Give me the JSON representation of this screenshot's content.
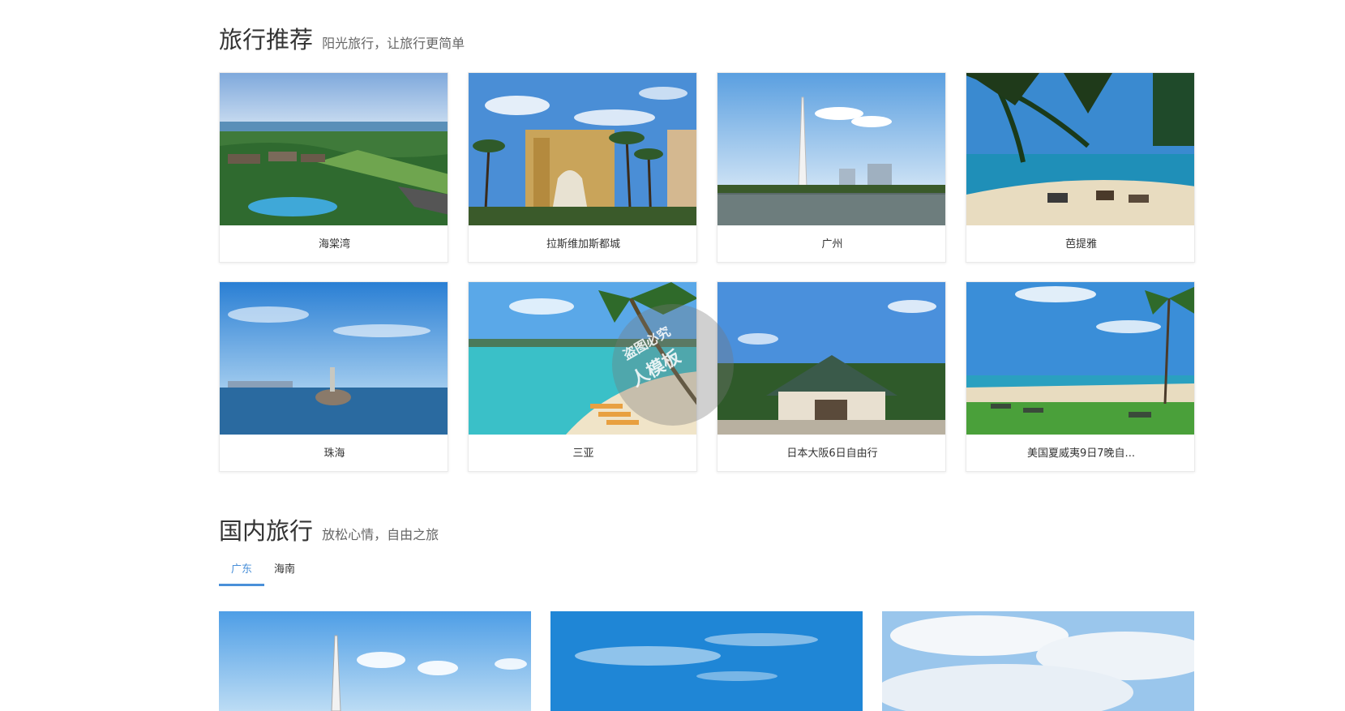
{
  "section1": {
    "title": "旅行推荐",
    "subtitle": "阳光旅行，让旅行更简单",
    "cards": [
      {
        "label": "海棠湾",
        "scene": "resort"
      },
      {
        "label": "拉斯维加斯都城",
        "scene": "vegas"
      },
      {
        "label": "广州",
        "scene": "tower"
      },
      {
        "label": "芭提雅",
        "scene": "palmbeach"
      },
      {
        "label": "珠海",
        "scene": "zhuhai"
      },
      {
        "label": "三亚",
        "scene": "sanya"
      },
      {
        "label": "日本大阪6日自由行",
        "scene": "temple"
      },
      {
        "label": "美国夏威夷9日7晚自...",
        "scene": "hawaii"
      }
    ]
  },
  "section2": {
    "title": "国内旅行",
    "subtitle": "放松心情，自由之旅",
    "tabs": [
      {
        "label": "广东",
        "active": true
      },
      {
        "label": "海南",
        "active": false
      }
    ],
    "images": [
      "tower-sky",
      "blue-sky",
      "clouds"
    ]
  },
  "watermark": {
    "line1": "盗图必究",
    "line2": "人模板"
  },
  "colors": {
    "accent": "#4a90d9"
  }
}
